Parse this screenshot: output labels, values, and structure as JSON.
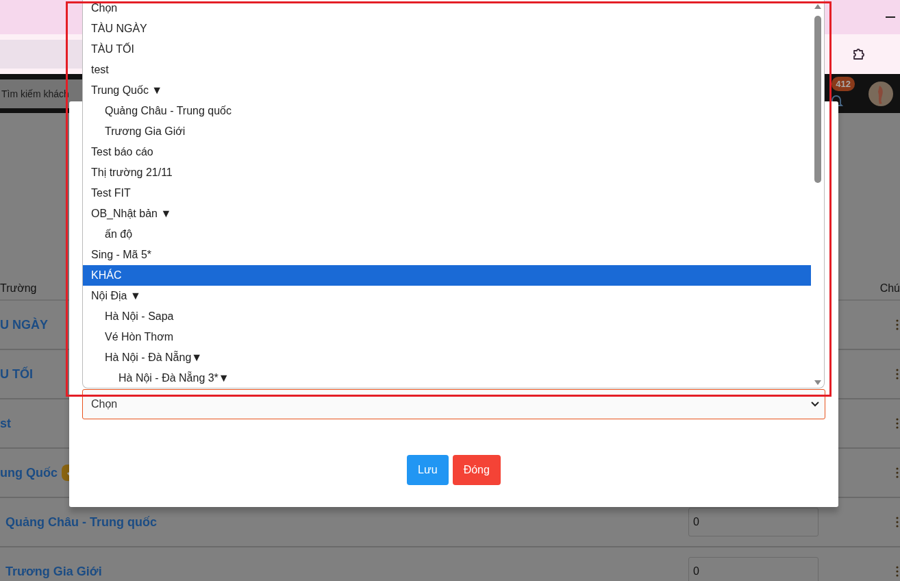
{
  "header": {
    "search": {
      "placeholder": "Tìm kiếm khách"
    },
    "notification_count": "412"
  },
  "table": {
    "columns": [
      "Trường",
      "Chú"
    ],
    "rows": [
      {
        "name": "U NGÀY",
        "badge": false
      },
      {
        "name": "U TỐI",
        "badge": false
      },
      {
        "name": "st",
        "badge": false
      },
      {
        "name": "ung Quốc",
        "badge": true,
        "children": [
          {
            "name": "Quảng Châu - Trung quốc",
            "badge": false,
            "value": "0"
          },
          {
            "name": "Trương Gia Giới",
            "badge": false,
            "value": "0"
          }
        ]
      }
    ]
  },
  "modal": {
    "select": {
      "value": "Chọn"
    },
    "buttons": [
      {
        "label": "Lưu",
        "kind": "primary"
      },
      {
        "label": "Đóng",
        "kind": "danger"
      }
    ]
  },
  "dropdown": {
    "options": [
      {
        "label": "Chọn",
        "selected": false
      },
      {
        "label": "TÀU NGÀY",
        "selected": false
      },
      {
        "label": "TÀU TỐI",
        "selected": false
      },
      {
        "label": "test",
        "selected": false
      },
      {
        "label": "Trung Quốc ▼",
        "selected": false,
        "children": [
          {
            "label": "Quảng Châu - Trung quốc",
            "selected": false
          },
          {
            "label": "Trương Gia Giới",
            "selected": false
          }
        ]
      },
      {
        "label": "Test báo cáo",
        "selected": false
      },
      {
        "label": "Thị trường 21/11",
        "selected": false
      },
      {
        "label": "Test FIT",
        "selected": false
      },
      {
        "label": "OB_Nhật bản ▼",
        "selected": false,
        "children": [
          {
            "label": "ấn độ",
            "selected": false
          }
        ]
      },
      {
        "label": "Sing - Mã 5*",
        "selected": false
      },
      {
        "label": "KHÁC",
        "selected": true
      },
      {
        "label": "Nội Địa ▼",
        "selected": false,
        "children": [
          {
            "label": "Hà Nội - Sapa",
            "selected": false
          },
          {
            "label": "Vé Hòn Thơm",
            "selected": false
          },
          {
            "label": "Hà Nội - Đà Nẵng▼",
            "selected": false,
            "children": [
              {
                "label": "Hà Nội - Đà Nẵng 3*▼",
                "selected": false
              }
            ]
          }
        ]
      }
    ]
  }
}
